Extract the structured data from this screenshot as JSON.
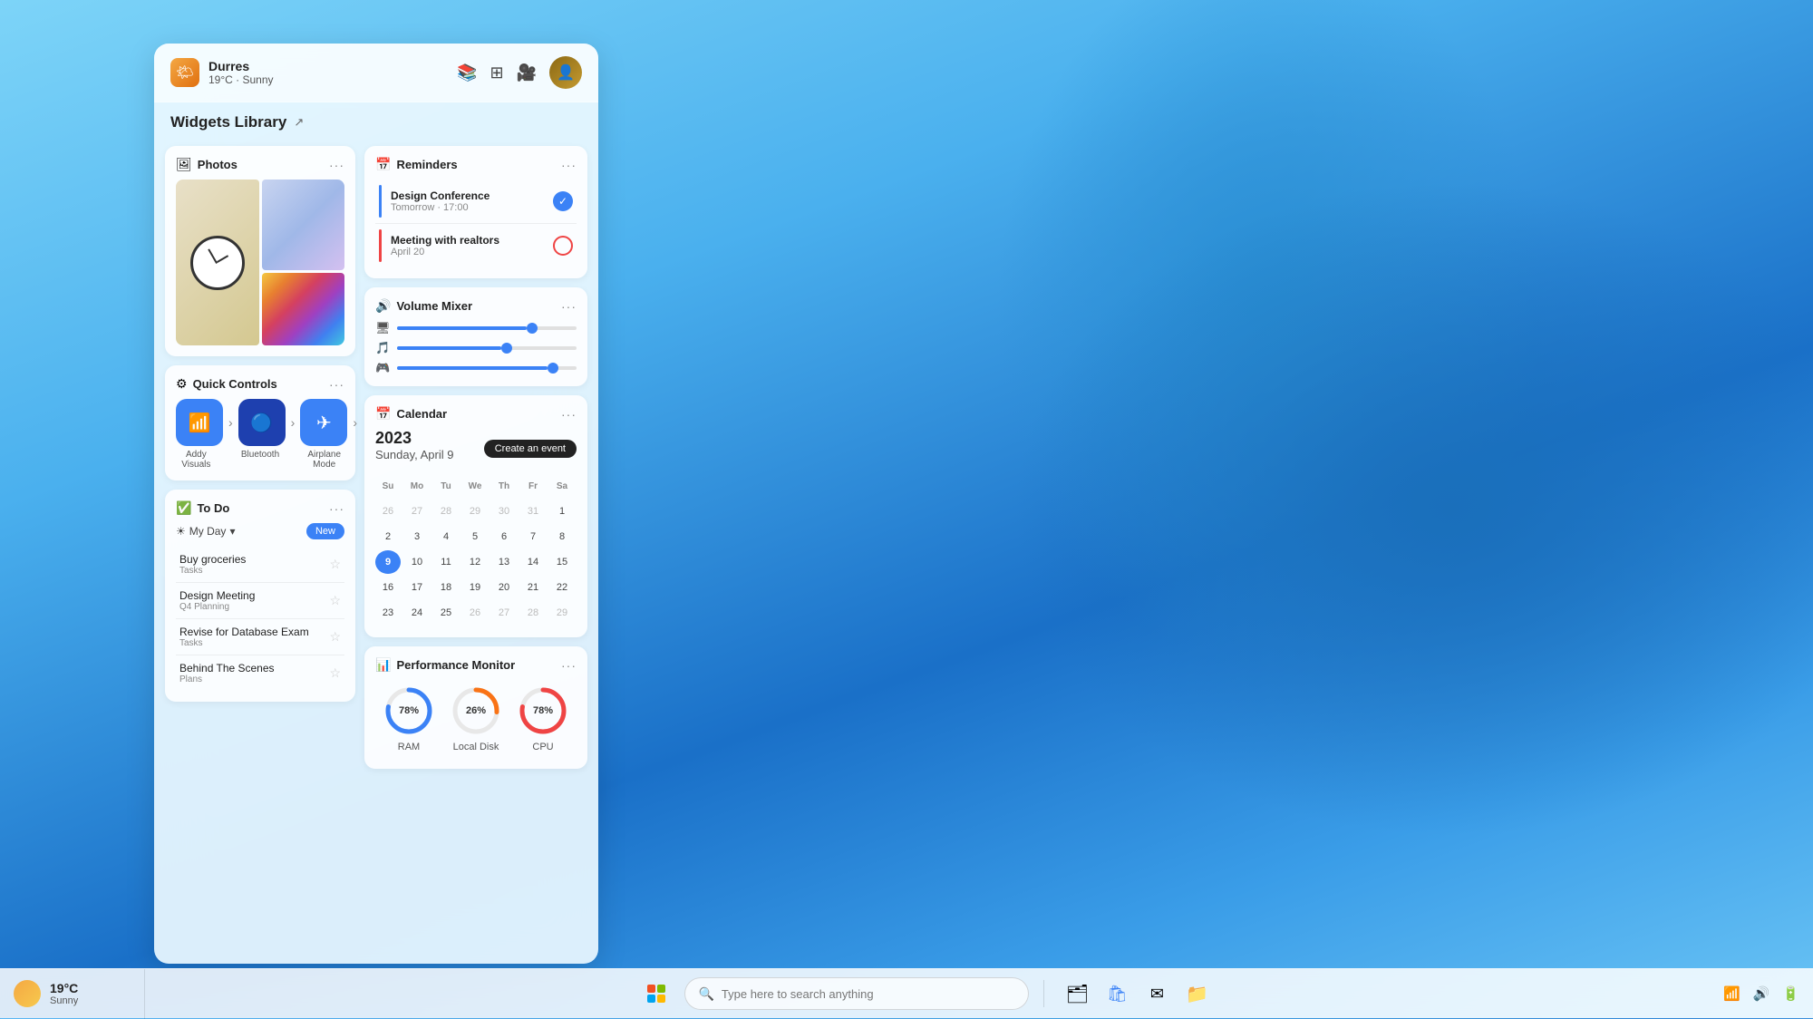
{
  "desktop": {
    "background": "blue_waves"
  },
  "panel": {
    "city": "Durres",
    "weather": "19°C · Sunny",
    "widgets_library_title": "Widgets Library",
    "expand_label": "↗"
  },
  "photos_widget": {
    "title": "Photos",
    "menu": "···"
  },
  "reminders_widget": {
    "title": "Reminders",
    "menu": "···",
    "items": [
      {
        "title": "Design Conference",
        "sub": "Tomorrow · 17:00",
        "type": "checked"
      },
      {
        "title": "Meeting with realtors",
        "sub": "April 20",
        "type": "circle"
      }
    ]
  },
  "volume_widget": {
    "title": "Volume Mixer",
    "menu": "···",
    "sliders": [
      {
        "icon": "🖥",
        "pct": 72
      },
      {
        "icon": "🎵",
        "pct": 58
      },
      {
        "icon": "🎮",
        "pct": 84
      }
    ]
  },
  "quick_controls": {
    "title": "Quick Controls",
    "menu": "···",
    "items": [
      {
        "label": "Addy Visuals",
        "icon": "📶"
      },
      {
        "label": "Bluetooth",
        "icon": "🔵"
      },
      {
        "label": "Airplane Mode",
        "icon": "✈"
      }
    ]
  },
  "todo_widget": {
    "title": "To Do",
    "menu": "···",
    "filter": "My Day",
    "new_btn": "New",
    "items": [
      {
        "title": "Buy groceries",
        "category": "Tasks"
      },
      {
        "title": "Design Meeting",
        "category": "Q4 Planning"
      },
      {
        "title": "Revise for Database Exam",
        "category": "Tasks"
      },
      {
        "title": "Behind The Scenes",
        "category": "Plans"
      }
    ]
  },
  "calendar_widget": {
    "title": "Calendar",
    "menu": "···",
    "year": "2023",
    "day_label": "Sunday, April 9",
    "create_event_btn": "Create an event",
    "headers": [
      "Su",
      "Mo",
      "Tu",
      "We",
      "Th",
      "Fr",
      "Sa"
    ],
    "weeks": [
      [
        "26",
        "27",
        "28",
        "29",
        "30",
        "31",
        "1"
      ],
      [
        "2",
        "3",
        "4",
        "5",
        "6",
        "7",
        "8"
      ],
      [
        "9",
        "10",
        "11",
        "12",
        "13",
        "14",
        "15"
      ],
      [
        "16",
        "17",
        "18",
        "19",
        "20",
        "21",
        "22"
      ],
      [
        "23",
        "24",
        "25",
        "26",
        "27",
        "28",
        "29"
      ]
    ],
    "today": "9",
    "first_row_other_month": [
      true,
      true,
      true,
      true,
      true,
      true,
      false
    ],
    "last_row_partial": [
      false,
      false,
      false,
      true,
      true,
      true,
      true
    ]
  },
  "perf_widget": {
    "title": "Performance Monitor",
    "menu": "···",
    "items": [
      {
        "label": "RAM",
        "pct": 78,
        "color": "blue"
      },
      {
        "label": "Local Disk",
        "pct": 26,
        "color": "orange"
      },
      {
        "label": "CPU",
        "pct": 78,
        "color": "red"
      }
    ]
  },
  "taskbar": {
    "weather_temp": "19°C",
    "weather_condition": "Sunny",
    "search_placeholder": "Type here to search anything",
    "apps": [
      "file_explorer",
      "store",
      "mail",
      "folder"
    ],
    "sys_icons": [
      "wifi",
      "volume",
      "battery"
    ]
  },
  "header": {
    "nav_icons": [
      "📚",
      "⊞",
      "📹"
    ]
  }
}
